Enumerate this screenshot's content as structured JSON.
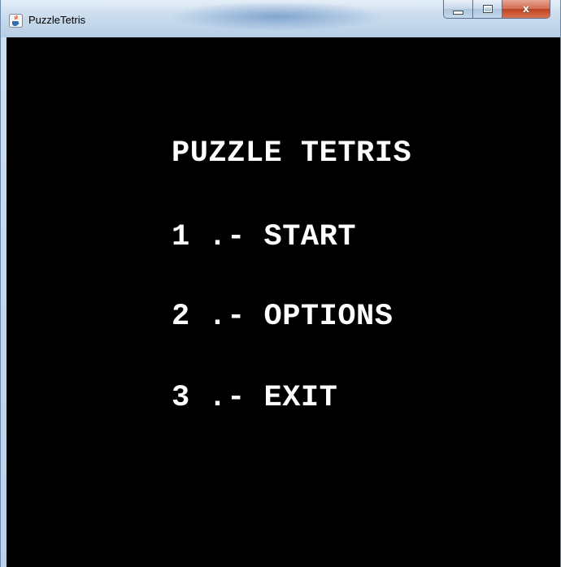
{
  "window": {
    "title": "PuzzleTetris",
    "icon": "java-cup-icon"
  },
  "caption": {
    "minimize_icon": "minimize-icon",
    "maximize_icon": "maximize-icon",
    "close_icon": "close-icon",
    "close_glyph": "x"
  },
  "menu": {
    "title": "PUZZLE TETRIS",
    "items": [
      {
        "label": "1 .- START"
      },
      {
        "label": "2 .- OPTIONS"
      },
      {
        "label": "3 .- EXIT"
      }
    ]
  },
  "colors": {
    "background": "#000000",
    "text": "#ffffff"
  }
}
